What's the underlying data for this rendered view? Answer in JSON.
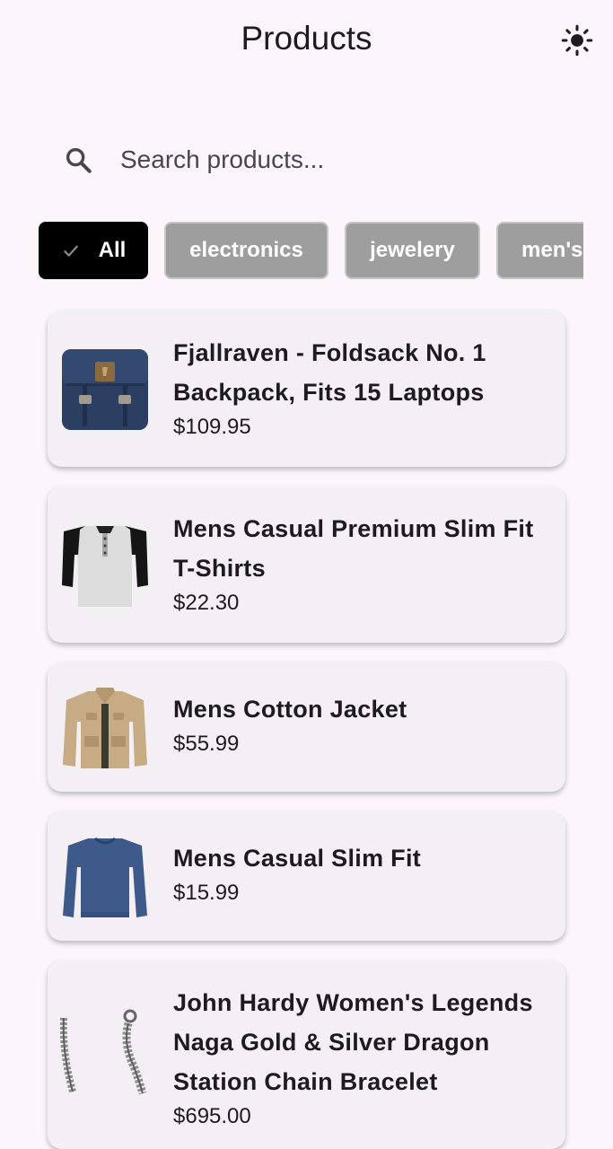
{
  "appbar": {
    "title": "Products",
    "theme_icon": "sun-icon"
  },
  "search": {
    "placeholder": "Search products...",
    "value": ""
  },
  "filters": [
    {
      "label": "All",
      "selected": true
    },
    {
      "label": "electronics",
      "selected": false
    },
    {
      "label": "jewelery",
      "selected": false
    },
    {
      "label": "men's",
      "selected": false
    }
  ],
  "products": [
    {
      "name": "Fjallraven - Foldsack No. 1 Backpack, Fits 15 Laptops",
      "price": "$109.95",
      "image": "backpack"
    },
    {
      "name": "Mens Casual Premium Slim Fit T-Shirts",
      "price": "$22.30",
      "image": "t-shirt"
    },
    {
      "name": "Mens Cotton Jacket",
      "price": "$55.99",
      "image": "jacket"
    },
    {
      "name": "Mens Casual Slim Fit",
      "price": "$15.99",
      "image": "long-sleeve-shirt"
    },
    {
      "name": "John Hardy Women's Legends Naga Gold & Silver Dragon Station Chain Bracelet",
      "price": "$695.00",
      "image": "bracelet"
    }
  ],
  "colors": {
    "background": "#fcf6fc",
    "card": "#f4eff5",
    "chip_selected": "#000000",
    "chip": "#9e9e9e"
  }
}
